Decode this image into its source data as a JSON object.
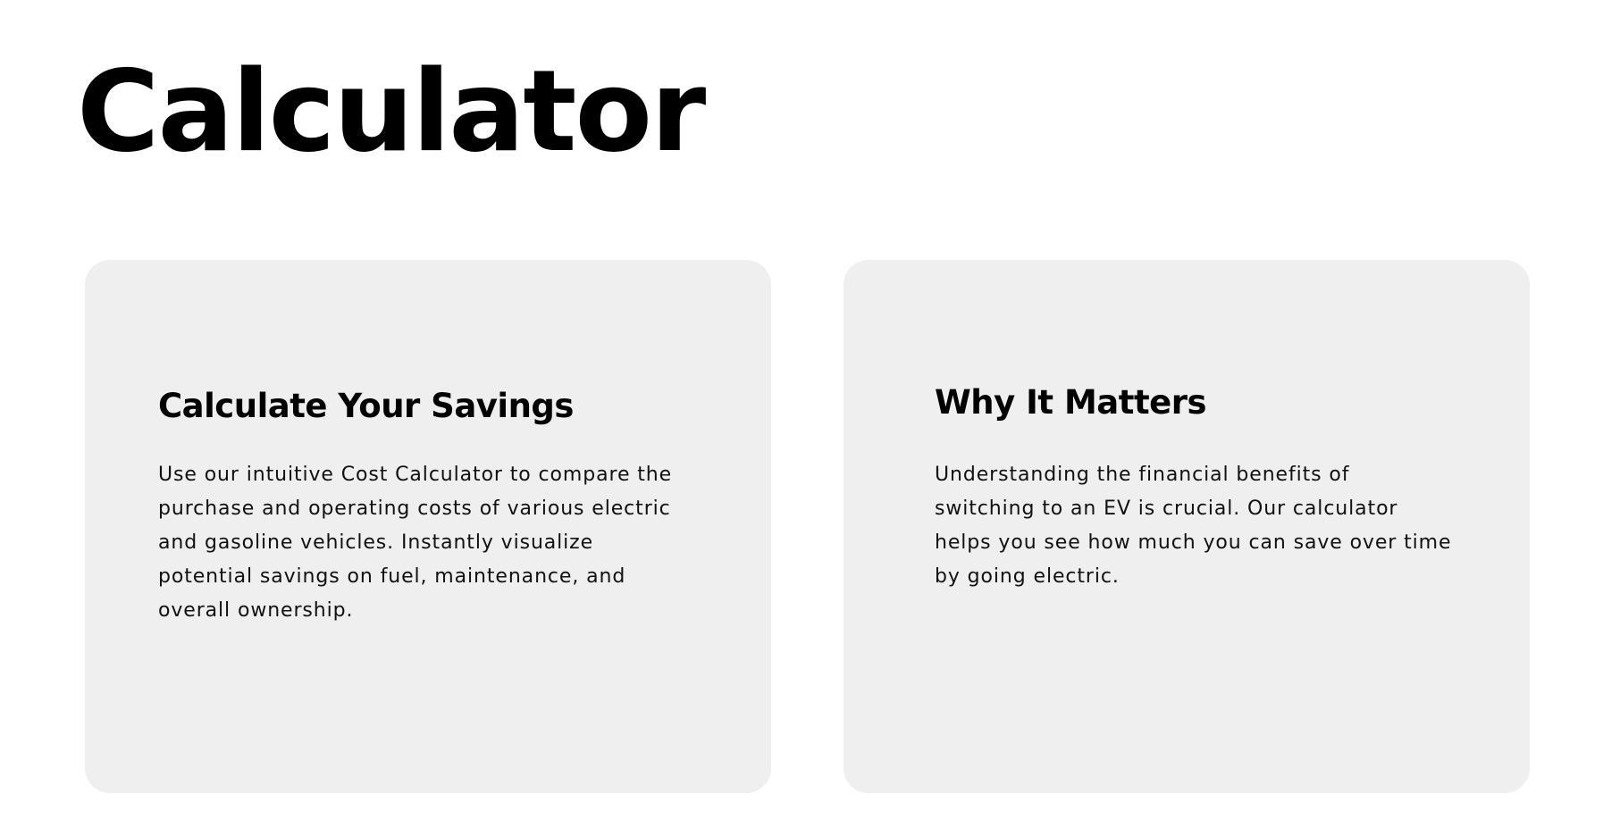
{
  "page": {
    "title": "Calculator"
  },
  "cards": [
    {
      "heading": "Calculate Your Savings",
      "body": "Use our intuitive Cost Calculator to compare the purchase and operating costs of various electric and gasoline vehicles. Instantly visualize potential savings on fuel, maintenance, and overall ownership."
    },
    {
      "heading": "Why It Matters",
      "body": "Understanding the financial benefits of switching to an EV is crucial. Our calculator helps you see how much you can save over time by going electric."
    }
  ],
  "colors": {
    "background": "#ffffff",
    "card_background": "#efefef",
    "text": "#000000"
  }
}
